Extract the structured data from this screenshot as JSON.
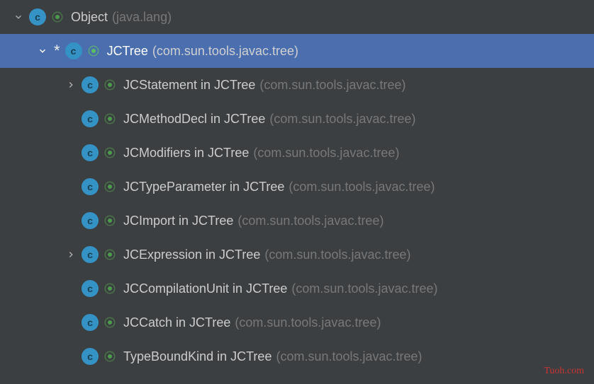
{
  "root": {
    "class_name": "Object",
    "package": "(java.lang)",
    "icon_letter": "c"
  },
  "level1": {
    "class_name": "JCTree",
    "package": "(com.sun.tools.javac.tree)",
    "icon_letter": "c"
  },
  "children": [
    {
      "class_name": "JCStatement in JCTree",
      "package": "(com.sun.tools.javac.tree)",
      "expandable": true,
      "icon_letter": "c"
    },
    {
      "class_name": "JCMethodDecl in JCTree",
      "package": "(com.sun.tools.javac.tree)",
      "expandable": false,
      "icon_letter": "c"
    },
    {
      "class_name": "JCModifiers in JCTree",
      "package": "(com.sun.tools.javac.tree)",
      "expandable": false,
      "icon_letter": "c"
    },
    {
      "class_name": "JCTypeParameter in JCTree",
      "package": "(com.sun.tools.javac.tree)",
      "expandable": false,
      "icon_letter": "c"
    },
    {
      "class_name": "JCImport in JCTree",
      "package": "(com.sun.tools.javac.tree)",
      "expandable": false,
      "icon_letter": "c"
    },
    {
      "class_name": "JCExpression in JCTree",
      "package": "(com.sun.tools.javac.tree)",
      "expandable": true,
      "icon_letter": "c"
    },
    {
      "class_name": "JCCompilationUnit in JCTree",
      "package": "(com.sun.tools.javac.tree)",
      "expandable": false,
      "icon_letter": "c"
    },
    {
      "class_name": "JCCatch in JCTree",
      "package": "(com.sun.tools.javac.tree)",
      "expandable": false,
      "icon_letter": "c"
    },
    {
      "class_name": "TypeBoundKind in JCTree",
      "package": "(com.sun.tools.javac.tree)",
      "expandable": false,
      "icon_letter": "c"
    }
  ],
  "watermark": "Tuoh.com"
}
